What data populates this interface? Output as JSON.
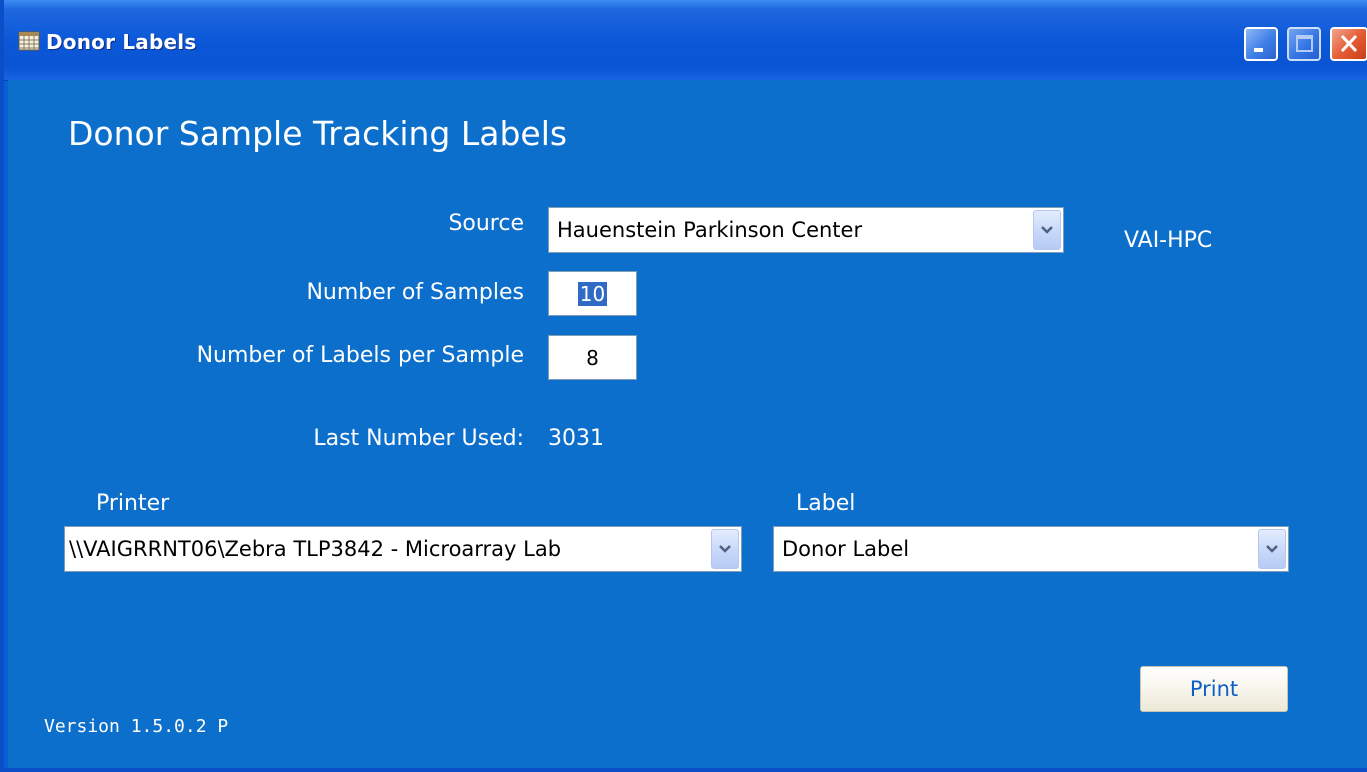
{
  "window": {
    "title": "Donor Labels",
    "accent_color": "#0c6fcb",
    "titlebar_icon": "calendar-grid-icon"
  },
  "main": {
    "heading": "Donor Sample Tracking Labels",
    "source": {
      "label": "Source",
      "value": "Hauenstein Parkinson Center",
      "code": "VAI-HPC"
    },
    "samples": {
      "label": "Number of Samples",
      "value": "10"
    },
    "labels_per_sample": {
      "label": "Number of Labels per Sample",
      "value": "8"
    },
    "last_number": {
      "label": "Last Number Used:",
      "value": "3031"
    },
    "printer": {
      "label": "Printer",
      "value": "\\\\VAIGRRNT06\\Zebra  TLP3842 - Microarray Lab"
    },
    "label_type": {
      "label": "Label",
      "value": "Donor Label"
    },
    "print_button": "Print",
    "version": "Version 1.5.0.2 P"
  }
}
